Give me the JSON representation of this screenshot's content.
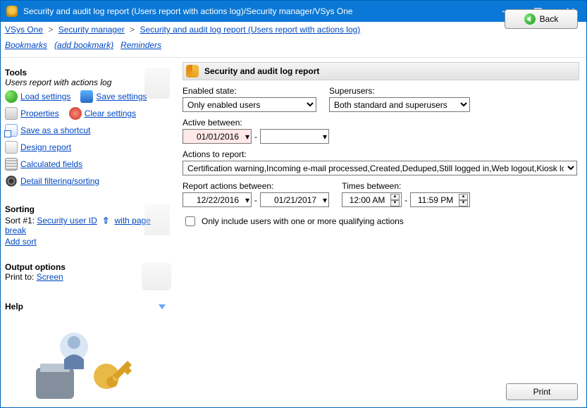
{
  "window": {
    "title": "Security and audit log report (Users report with actions log)/Security manager/VSys One"
  },
  "breadcrumb": {
    "items": [
      "VSys One",
      "Security manager",
      "Security and audit log report (Users report with actions log)"
    ]
  },
  "bookbar": {
    "bookmarks": "Bookmarks",
    "add_bookmark": "(add bookmark)",
    "reminders": "Reminders"
  },
  "back_button": "Back",
  "left": {
    "tools_head": "Tools",
    "subtitle": "Users report with actions log",
    "load_settings": "Load settings",
    "save_settings": "Save settings",
    "properties": "Properties",
    "clear_settings": "Clear settings",
    "save_shortcut": "Save as a shortcut",
    "design_report": "Design report",
    "calculated_fields": "Calculated fields",
    "detail_filter": "Detail filtering/sorting",
    "sorting_head": "Sorting",
    "sort_label": "Sort #1:",
    "sort_field": "Security user ID",
    "sort_pagebreak": "with page break",
    "add_sort": "Add sort",
    "output_head": "Output options",
    "print_to_label": "Print to:",
    "print_to_value": "Screen",
    "help_head": "Help"
  },
  "report": {
    "title": "Security and audit log report",
    "enabled_label": "Enabled state:",
    "enabled_value": "Only enabled users",
    "superusers_label": "Superusers:",
    "superusers_value": "Both standard and superusers",
    "active_label": "Active between:",
    "active_from": "01/01/2016",
    "active_to": "",
    "actions_label": "Actions to report:",
    "actions_value": "Certification warning,Incoming e-mail processed,Created,Deduped,Still logged in,Web logout,Kiosk login failure,R",
    "report_between_label": "Report actions between:",
    "report_from": "12/22/2016",
    "report_to": "01/21/2017",
    "times_label": "Times between:",
    "time_from": "12:00 AM",
    "time_to": "11:59 PM",
    "only_include": "Only include users with one or more qualifying actions"
  },
  "print_button": "Print"
}
